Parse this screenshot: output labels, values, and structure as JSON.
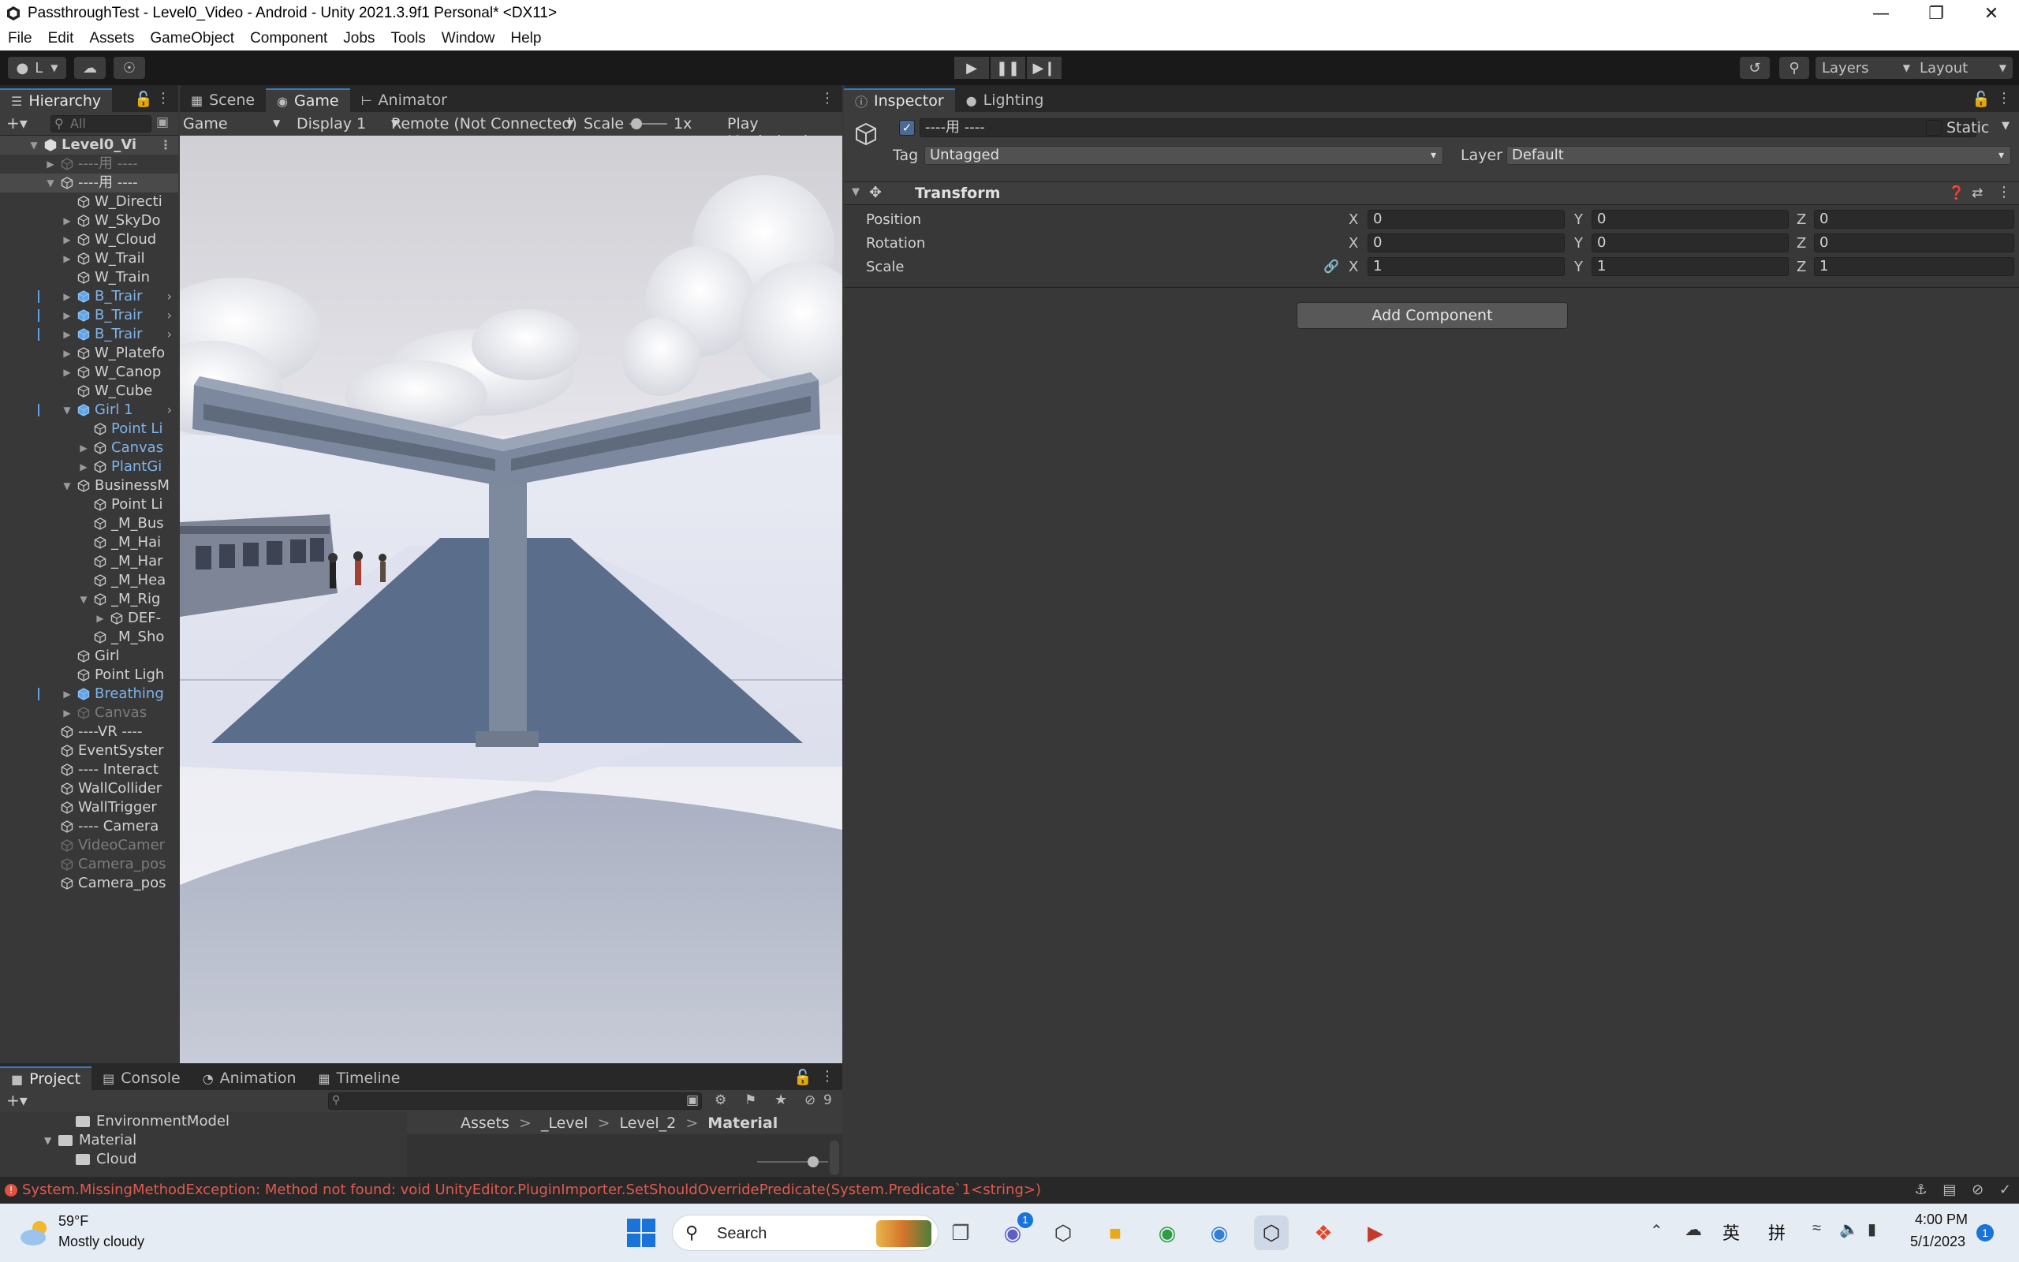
{
  "window": {
    "title": "PassthroughTest - Level0_Video - Android - Unity 2021.3.9f1 Personal* <DX11>"
  },
  "menu": [
    "File",
    "Edit",
    "Assets",
    "GameObject",
    "Component",
    "Jobs",
    "Tools",
    "Window",
    "Help"
  ],
  "toolbar": {
    "account_label": "L",
    "layers_label": "Layers",
    "layout_label": "Layout"
  },
  "hierarchy": {
    "tab_label": "Hierarchy",
    "search_placeholder": "All",
    "items": [
      {
        "label": "Level0_Vi",
        "indent": 0,
        "arrow": "down",
        "state": "root",
        "icon": "unity-scene-icon"
      },
      {
        "label": "----用 ----",
        "indent": 1,
        "arrow": "right",
        "state": "disabled",
        "icon": "cube-icon"
      },
      {
        "label": "----用 ----",
        "indent": 1,
        "arrow": "down",
        "state": "selected",
        "icon": "cube-icon"
      },
      {
        "label": "W_Directi",
        "indent": 2,
        "arrow": "",
        "state": "normal",
        "icon": "cube-icon"
      },
      {
        "label": "W_SkyDo",
        "indent": 2,
        "arrow": "right",
        "state": "normal",
        "icon": "cube-icon"
      },
      {
        "label": "W_Cloud",
        "indent": 2,
        "arrow": "right",
        "state": "normal",
        "icon": "cube-icon"
      },
      {
        "label": "W_Trail",
        "indent": 2,
        "arrow": "right",
        "state": "normal",
        "icon": "cube-icon"
      },
      {
        "label": "W_Train",
        "indent": 2,
        "arrow": "",
        "state": "normal",
        "icon": "cube-icon"
      },
      {
        "label": "B_Trair",
        "indent": 2,
        "arrow": "right",
        "state": "prefab",
        "icon": "prefab-icon",
        "chevron": true
      },
      {
        "label": "B_Trair",
        "indent": 2,
        "arrow": "right",
        "state": "prefab",
        "icon": "prefab-icon",
        "chevron": true
      },
      {
        "label": "B_Trair",
        "indent": 2,
        "arrow": "right",
        "state": "prefab",
        "icon": "prefab-icon",
        "chevron": true
      },
      {
        "label": "W_Platefo",
        "indent": 2,
        "arrow": "right",
        "state": "normal",
        "icon": "cube-icon"
      },
      {
        "label": "W_Canop",
        "indent": 2,
        "arrow": "right",
        "state": "normal",
        "icon": "cube-icon"
      },
      {
        "label": "W_Cube",
        "indent": 2,
        "arrow": "",
        "state": "normal",
        "icon": "cube-icon"
      },
      {
        "label": "Girl 1",
        "indent": 2,
        "arrow": "down",
        "state": "prefab",
        "icon": "prefab-icon",
        "chevron": true
      },
      {
        "label": "Point Li",
        "indent": 3,
        "arrow": "",
        "state": "prefab",
        "icon": "cube-icon"
      },
      {
        "label": "Canvas",
        "indent": 3,
        "arrow": "right",
        "state": "prefab",
        "icon": "cube-icon"
      },
      {
        "label": "PlantGi",
        "indent": 3,
        "arrow": "right",
        "state": "prefab",
        "icon": "cube-icon"
      },
      {
        "label": "BusinessM",
        "indent": 2,
        "arrow": "down",
        "state": "normal",
        "icon": "cube-icon"
      },
      {
        "label": "Point Li",
        "indent": 3,
        "arrow": "",
        "state": "normal",
        "icon": "cube-icon"
      },
      {
        "label": "_M_Bus",
        "indent": 3,
        "arrow": "",
        "state": "normal",
        "icon": "cube-icon"
      },
      {
        "label": "_M_Hai",
        "indent": 3,
        "arrow": "",
        "state": "normal",
        "icon": "cube-icon"
      },
      {
        "label": "_M_Har",
        "indent": 3,
        "arrow": "",
        "state": "normal",
        "icon": "cube-icon"
      },
      {
        "label": "_M_Hea",
        "indent": 3,
        "arrow": "",
        "state": "normal",
        "icon": "cube-icon"
      },
      {
        "label": "_M_Rig",
        "indent": 3,
        "arrow": "down",
        "state": "normal",
        "icon": "cube-icon"
      },
      {
        "label": "DEF-",
        "indent": 4,
        "arrow": "right",
        "state": "normal",
        "icon": "cube-icon"
      },
      {
        "label": "_M_Sho",
        "indent": 3,
        "arrow": "",
        "state": "normal",
        "icon": "cube-icon"
      },
      {
        "label": "Girl",
        "indent": 2,
        "arrow": "",
        "state": "normal",
        "icon": "cube-icon"
      },
      {
        "label": "Point Ligh",
        "indent": 2,
        "arrow": "",
        "state": "normal",
        "icon": "cube-icon"
      },
      {
        "label": "Breathing",
        "indent": 2,
        "arrow": "right",
        "state": "prefab",
        "icon": "prefab-icon"
      },
      {
        "label": "Canvas",
        "indent": 2,
        "arrow": "right",
        "state": "disabled",
        "icon": "cube-icon"
      },
      {
        "label": "----VR ----",
        "indent": 1,
        "arrow": "",
        "state": "normal",
        "icon": "cube-icon"
      },
      {
        "label": "EventSyster",
        "indent": 1,
        "arrow": "",
        "state": "normal",
        "icon": "cube-icon"
      },
      {
        "label": "---- Interact",
        "indent": 1,
        "arrow": "",
        "state": "normal",
        "icon": "cube-icon"
      },
      {
        "label": "WallCollider",
        "indent": 1,
        "arrow": "",
        "state": "normal",
        "icon": "cube-icon"
      },
      {
        "label": "WallTrigger",
        "indent": 1,
        "arrow": "",
        "state": "normal",
        "icon": "cube-icon"
      },
      {
        "label": "---- Camera",
        "indent": 1,
        "arrow": "",
        "state": "normal",
        "icon": "cube-icon"
      },
      {
        "label": "VideoCamer",
        "indent": 1,
        "arrow": "",
        "state": "disabled",
        "icon": "cube-icon"
      },
      {
        "label": "Camera_pos",
        "indent": 1,
        "arrow": "",
        "state": "disabled",
        "icon": "cube-icon"
      },
      {
        "label": "Camera_pos",
        "indent": 1,
        "arrow": "",
        "state": "normal",
        "icon": "cube-icon"
      }
    ]
  },
  "game_panel": {
    "tabs": [
      {
        "label": "Scene",
        "icon": "grid-icon",
        "active": false
      },
      {
        "label": "Game",
        "icon": "gamepad-icon",
        "active": true
      },
      {
        "label": "Animator",
        "icon": "animator-icon",
        "active": false
      }
    ],
    "view_dropdown": "Game",
    "display_dropdown": "Display 1",
    "remote_dropdown": "Remote (Not Connected)",
    "scale_label": "Scale",
    "scale_value": "1x",
    "play_mode": "Play Maximized"
  },
  "inspector": {
    "tabs": [
      {
        "label": "Inspector",
        "icon": "info-icon",
        "active": true
      },
      {
        "label": "Lighting",
        "icon": "bulb-icon",
        "active": false
      }
    ],
    "object_name": "----用 ----",
    "active_checked": true,
    "static_label": "Static",
    "tag_label": "Tag",
    "tag_value": "Untagged",
    "layer_label": "Layer",
    "layer_value": "Default",
    "component_title": "Transform",
    "position_label": "Position",
    "rotation_label": "Rotation",
    "scale_label": "Scale",
    "position": {
      "x": "0",
      "y": "0",
      "z": "0"
    },
    "rotation": {
      "x": "0",
      "y": "0",
      "z": "0"
    },
    "scale": {
      "x": "1",
      "y": "1",
      "z": "1"
    },
    "axis_x": "X",
    "axis_y": "Y",
    "axis_z": "Z",
    "add_component_label": "Add Component"
  },
  "project_panel": {
    "tabs": [
      {
        "label": "Project",
        "icon": "folder-icon",
        "active": true
      },
      {
        "label": "Console",
        "icon": "console-icon",
        "active": false
      },
      {
        "label": "Animation",
        "icon": "animation-icon",
        "active": false
      },
      {
        "label": "Timeline",
        "icon": "timeline-icon",
        "active": false
      }
    ],
    "hidden_count": "9",
    "tree": [
      {
        "label": "EnvironmentModel",
        "indent": 3,
        "arrow": ""
      },
      {
        "label": "Material",
        "indent": 2,
        "arrow": "down"
      },
      {
        "label": "Cloud",
        "indent": 3,
        "arrow": ""
      }
    ],
    "breadcrumb": [
      "Assets",
      "_Level",
      "Level_2",
      "Material"
    ]
  },
  "status": {
    "error_message": "System.MissingMethodException: Method not found: void UnityEditor.PluginImporter.SetShouldOverridePredicate(System.Predicate`1<string>)"
  },
  "taskbar": {
    "temperature": "59°F",
    "weather": "Mostly cloudy",
    "search_label": "Search",
    "ime_label_1": "英",
    "ime_label_2": "拼",
    "time": "4:00 PM",
    "date": "5/1/2023",
    "teams_badge": "1",
    "notification_count": "1"
  }
}
